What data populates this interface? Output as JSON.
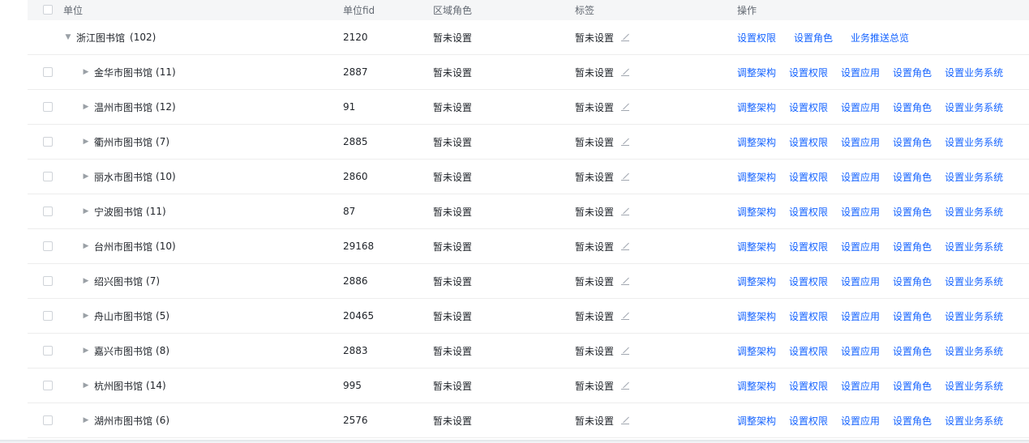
{
  "header": {
    "unit_label": "单位",
    "fid_label": "单位fid",
    "role_label": "区域角色",
    "tag_label": "标签",
    "ops_label": "操作"
  },
  "parent": {
    "name": "浙江图书馆",
    "count": "(102)",
    "fid": "2120",
    "role": "暂未设置",
    "tag": "暂未设置",
    "actions": [
      "设置权限",
      "设置角色",
      "业务推送总览"
    ]
  },
  "rows": [
    {
      "name": "金华市图书馆",
      "count": "(11)",
      "fid": "2887",
      "role": "暂未设置",
      "tag": "暂未设置"
    },
    {
      "name": "温州市图书馆",
      "count": "(12)",
      "fid": "91",
      "role": "暂未设置",
      "tag": "暂未设置"
    },
    {
      "name": "衢州市图书馆",
      "count": "(7)",
      "fid": "2885",
      "role": "暂未设置",
      "tag": "暂未设置"
    },
    {
      "name": "丽水市图书馆",
      "count": "(10)",
      "fid": "2860",
      "role": "暂未设置",
      "tag": "暂未设置"
    },
    {
      "name": "宁波图书馆",
      "count": "(11)",
      "fid": "87",
      "role": "暂未设置",
      "tag": "暂未设置"
    },
    {
      "name": "台州市图书馆",
      "count": "(10)",
      "fid": "29168",
      "role": "暂未设置",
      "tag": "暂未设置"
    },
    {
      "name": "绍兴图书馆",
      "count": "(7)",
      "fid": "2886",
      "role": "暂未设置",
      "tag": "暂未设置"
    },
    {
      "name": "舟山市图书馆",
      "count": "(5)",
      "fid": "20465",
      "role": "暂未设置",
      "tag": "暂未设置"
    },
    {
      "name": "嘉兴市图书馆",
      "count": "(8)",
      "fid": "2883",
      "role": "暂未设置",
      "tag": "暂未设置"
    },
    {
      "name": "杭州图书馆",
      "count": "(14)",
      "fid": "995",
      "role": "暂未设置",
      "tag": "暂未设置"
    },
    {
      "name": "湖州市图书馆",
      "count": "(6)",
      "fid": "2576",
      "role": "暂未设置",
      "tag": "暂未设置"
    }
  ],
  "row_actions": [
    "调整架构",
    "设置权限",
    "设置应用",
    "设置角色",
    "设置业务系统"
  ],
  "colors": {
    "link": "#1664ff",
    "header_bg": "#f5f6f7",
    "border": "#ededed"
  }
}
